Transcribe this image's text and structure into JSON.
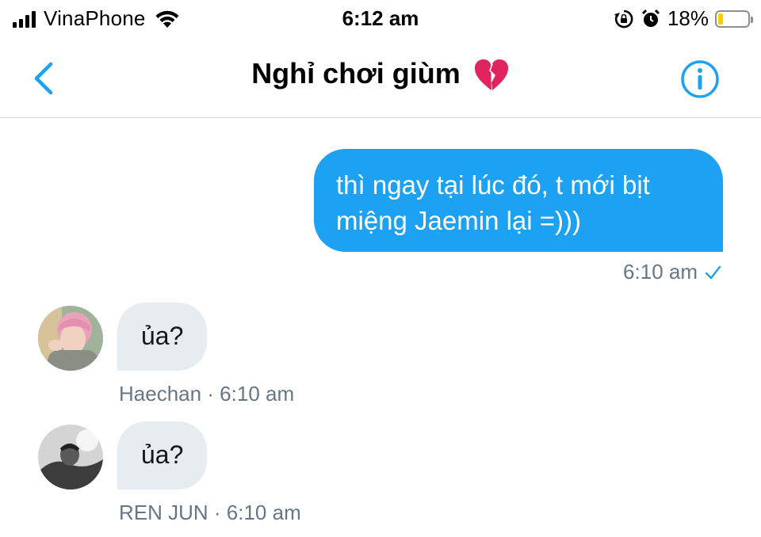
{
  "status_bar": {
    "carrier": "VinaPhone",
    "time": "6:12 am",
    "battery_percent": "18%",
    "battery_level": 0.18,
    "icons": [
      "signal-icon",
      "wifi-icon",
      "rotation-lock-icon",
      "alarm-icon",
      "battery-icon"
    ]
  },
  "header": {
    "title": "Nghỉ chơi giùm",
    "title_emoji": "broken-heart-icon",
    "back_icon": "chevron-left-icon",
    "info_icon": "info-icon"
  },
  "messages": [
    {
      "direction": "outgoing",
      "lines": [
        "thì ngay tại lúc đó, t mới bịt",
        "miệng Jaemin lại =)))"
      ],
      "meta": "6:10 am",
      "status_icon": "checkmark-icon"
    },
    {
      "direction": "incoming",
      "text": "ủa?",
      "meta": "Haechan · 6:10 am"
    },
    {
      "direction": "incoming",
      "text": "ủa?",
      "meta": "REN JUN · 6:10 am"
    }
  ],
  "colors": {
    "accent": "#1da1f2",
    "incoming_bubble": "#e6ecf0",
    "meta_text": "#657786",
    "battery": "#ffcc00"
  }
}
